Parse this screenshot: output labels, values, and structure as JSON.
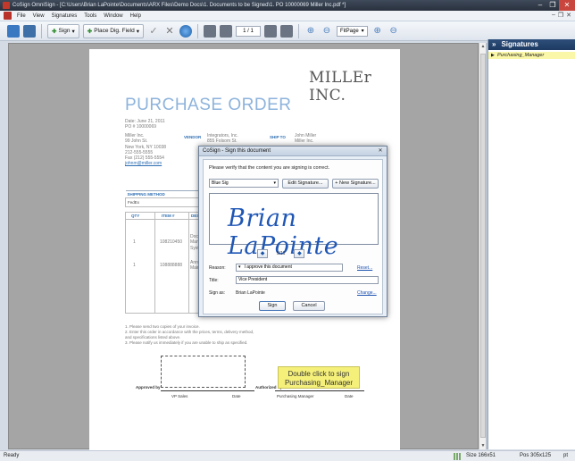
{
  "window": {
    "title": "CoSign OmniSign - [C:\\Users\\Brian LaPointe\\Documents\\ARX Files\\Demo Docs\\1. Documents to be Signed\\1. PO 10000069 Miller Inc.pdf *]",
    "min": "–",
    "max": "❐",
    "close": "✕"
  },
  "menu": [
    "File",
    "View",
    "Signatures",
    "Tools",
    "Window",
    "Help"
  ],
  "toolbar": {
    "sign_label": "Sign",
    "place_field_label": "Place Dig. Field",
    "page_indicator": "1 / 1",
    "zoom_value": "FitPage"
  },
  "document": {
    "company_logo": "MILLEr INC.",
    "title": "PURCHASE ORDER",
    "date_line": "Date: June 21, 2011",
    "po_line": "PO # 10000069",
    "buyer": [
      "Miller Inc.",
      "99 John St.",
      "New York, NY 10038",
      "212-555-5555",
      "Fax (212) 555-5554",
      "johnm@miller.com"
    ],
    "vendor_label": "VENDOR",
    "vendor": [
      "Integrators, Inc.",
      "855 Folsom St."
    ],
    "shipto_label": "SHIP TO",
    "shipto": [
      "John Miller",
      "Miller Inc."
    ],
    "shipping_headers": [
      "SHIPPING METHOD",
      "SHIPPI"
    ],
    "shipping_values": [
      "FedEx",
      "Within"
    ],
    "item_headers": [
      "QTY",
      "ITEM #",
      "DESC"
    ],
    "items": [
      {
        "qty": "1",
        "item": "108210450",
        "desc": "Docu Mana Syste"
      },
      {
        "qty": "1",
        "item": "108888888",
        "desc": "Annu Maint"
      }
    ],
    "notes": [
      "1.  Please send two copies of your invoice.",
      "2.  Enter this order in accordance with the prices, terms, delivery method, and specifications listed above.",
      "3.  Please notify us immediately if you are unable to ship as specified."
    ],
    "approved_by": "Approved by",
    "authorized_by": "Authorized by",
    "vp_sales": "VP Sales",
    "date1": "Date",
    "purchasing_manager": "Purchasing Manager",
    "date2": "Date",
    "sigfield_line1": "Double click to sign",
    "sigfield_line2": "Purchasing_Manager"
  },
  "dialog": {
    "title": "CoSign - Sign this document",
    "verify_text": "Please verify that the content you are signing is correct.",
    "graphic_select": "Blue Sig",
    "edit_signature": "Edit Signature...",
    "new_signature": "+ New Signature...",
    "signature_graphic": "Brian LaPointe",
    "counter": "5/11",
    "reason_label": "Reason:",
    "reason_value": "I approve this document",
    "reset_link": "Reset...",
    "title_label": "Title:",
    "title_value": "Vice President",
    "signas_label": "Sign as:",
    "signas_value": "Brian LaPointe",
    "change_link": "Change...",
    "sign_button": "Sign",
    "cancel_button": "Cancel"
  },
  "signatures_panel": {
    "header": "Signatures",
    "items": [
      "Purchasing_Manager"
    ]
  },
  "status": {
    "ready": "Ready",
    "size": "Size  166x51",
    "pos": "Pos  305x125",
    "unit": "pt"
  }
}
